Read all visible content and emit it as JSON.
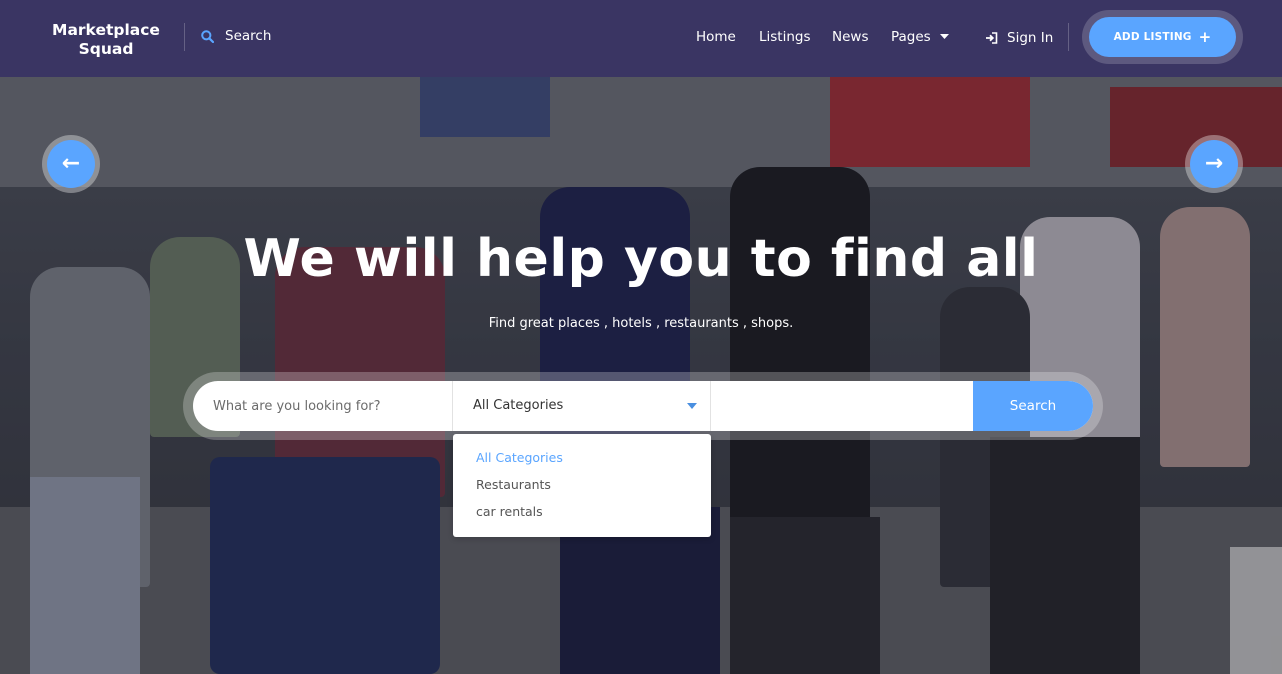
{
  "header": {
    "logo_line1": "Marketplace",
    "logo_line2": "Squad",
    "search_label": "Search",
    "nav": {
      "home": "Home",
      "listings": "Listings",
      "news": "News",
      "pages": "Pages"
    },
    "signin": "Sign In",
    "add_listing": "ADD LISTING",
    "add_listing_icon": "+"
  },
  "hero": {
    "prev_icon": "←",
    "next_icon": "→",
    "headline": "We will help you to find all",
    "subline": "Find great places , hotels , restaurants , shops.",
    "search": {
      "keyword_placeholder": "What are you looking for?",
      "keyword_value": "",
      "category_selected": "All Categories",
      "location_value": "",
      "button": "Search"
    },
    "category_options": [
      {
        "label": "All Categories"
      },
      {
        "label": "Restaurants"
      },
      {
        "label": "car rentals"
      }
    ]
  },
  "colors": {
    "header_bg": "#3a3563",
    "accent": "#5aa5ff",
    "dropdown_active": "#5aa5ff"
  },
  "icons": [
    "search-icon",
    "sign-in-icon",
    "plus-icon",
    "chevron-down-icon",
    "arrow-left-icon",
    "arrow-right-icon"
  ]
}
